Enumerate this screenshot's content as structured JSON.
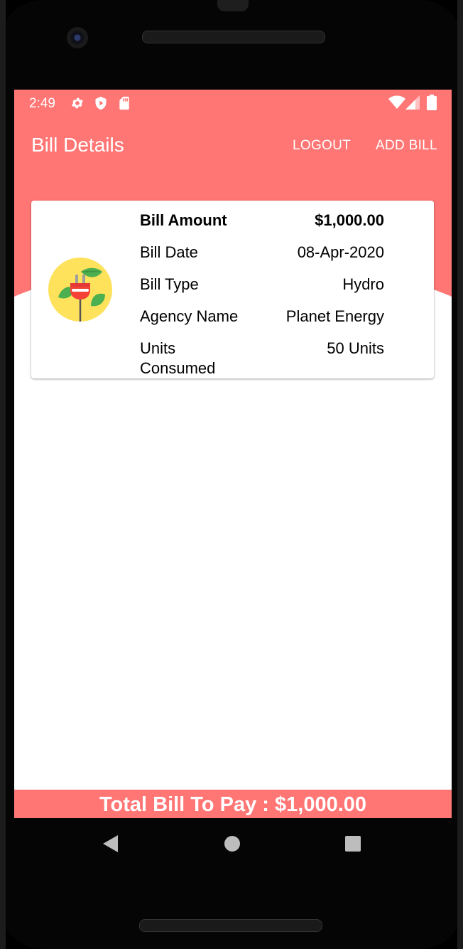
{
  "status_bar": {
    "time": "2:49",
    "left_icons": [
      "gear-icon",
      "shield-icon",
      "sd-card-icon"
    ],
    "right_icons": [
      "wifi-icon",
      "signal-icon",
      "battery-icon"
    ]
  },
  "app_bar": {
    "title": "Bill Details",
    "actions": [
      "LOGOUT",
      "ADD BILL"
    ],
    "color": "#ff7675"
  },
  "bill_card": {
    "icon": "eco-plug-icon",
    "rows": [
      {
        "label": "Bill Amount",
        "value": "$1,000.00",
        "bold": true
      },
      {
        "label": "Bill Date",
        "value": "08-Apr-2020"
      },
      {
        "label": "Bill Type",
        "value": "Hydro"
      },
      {
        "label": "Agency Name",
        "value": "Planet Energy"
      },
      {
        "label": "Units Consumed",
        "value": "50 Units"
      }
    ]
  },
  "footer": {
    "total_text": "Total Bill To Pay : $1,000.00"
  },
  "nav_bar": {
    "buttons": [
      "back-icon",
      "home-icon",
      "recents-icon"
    ]
  }
}
